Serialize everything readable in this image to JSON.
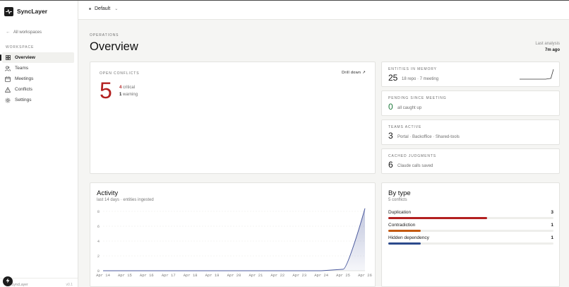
{
  "app": {
    "name": "SyncLayer",
    "version": "v0.1"
  },
  "sidebar": {
    "back_label": "All workspaces",
    "section_label": "WORKSPACE",
    "items": [
      {
        "label": "Overview",
        "icon": "grid-icon",
        "active": true
      },
      {
        "label": "Teams",
        "icon": "users-icon"
      },
      {
        "label": "Meetings",
        "icon": "calendar-icon"
      },
      {
        "label": "Conflicts",
        "icon": "warning-icon"
      },
      {
        "label": "Settings",
        "icon": "gear-icon"
      }
    ],
    "footer_name": "SyncLayer"
  },
  "header": {
    "workspace": "Default"
  },
  "page": {
    "eyebrow": "OPERATIONS",
    "title": "Overview",
    "last_analysis_label": "Last analysis",
    "last_analysis_value": "7m ago"
  },
  "conflicts": {
    "kicker": "OPEN CONFLICTS",
    "drill": "Drill down ↗",
    "total": "5",
    "critical_count": "4",
    "critical_label": "critical",
    "warning_count": "1",
    "warning_label": "warning"
  },
  "stats": [
    {
      "kicker": "ENTITIES IN MEMORY",
      "value": "25",
      "detail": "18 repo · 7 meeting",
      "sparkline": [
        0,
        0,
        0,
        0,
        0,
        0,
        0,
        0,
        0,
        0,
        0,
        1,
        2,
        25
      ]
    },
    {
      "kicker": "PENDING SINCE MEETING",
      "value": "0",
      "detail": "all caught up"
    },
    {
      "kicker": "TEAMS ACTIVE",
      "value": "3",
      "detail": "Portal · Backoffice · Shared-tools"
    },
    {
      "kicker": "CACHED JUDGMENTS",
      "value": "6",
      "detail": "Claude calls saved"
    }
  ],
  "activity": {
    "title": "Activity",
    "subtitle": "last 14 days · entities ingested"
  },
  "chart_data": {
    "type": "area",
    "x": [
      "Apr 14",
      "Apr 15",
      "Apr 16",
      "Apr 17",
      "Apr 18",
      "Apr 19",
      "Apr 20",
      "Apr 21",
      "Apr 22",
      "Apr 23",
      "Apr 24",
      "Apr 25",
      "Apr 26"
    ],
    "y": [
      0,
      0,
      0,
      0,
      0,
      0,
      0,
      0,
      0,
      0,
      0,
      0.2,
      8.4
    ],
    "yticks": [
      "8",
      "6",
      "4",
      "2",
      "0"
    ],
    "ylim": [
      0,
      8
    ],
    "grid": true,
    "color": "#4b5a9e"
  },
  "bytype": {
    "title": "By type",
    "subtitle": "5 conflicts",
    "total": 5,
    "rows": [
      {
        "label": "Duplication",
        "count": "3",
        "value": 3,
        "color": "#b32020"
      },
      {
        "label": "Contradiction",
        "count": "1",
        "value": 1,
        "color": "#c45a12"
      },
      {
        "label": "Hidden dependency",
        "count": "1",
        "value": 1,
        "color": "#2c4a8c"
      }
    ]
  }
}
